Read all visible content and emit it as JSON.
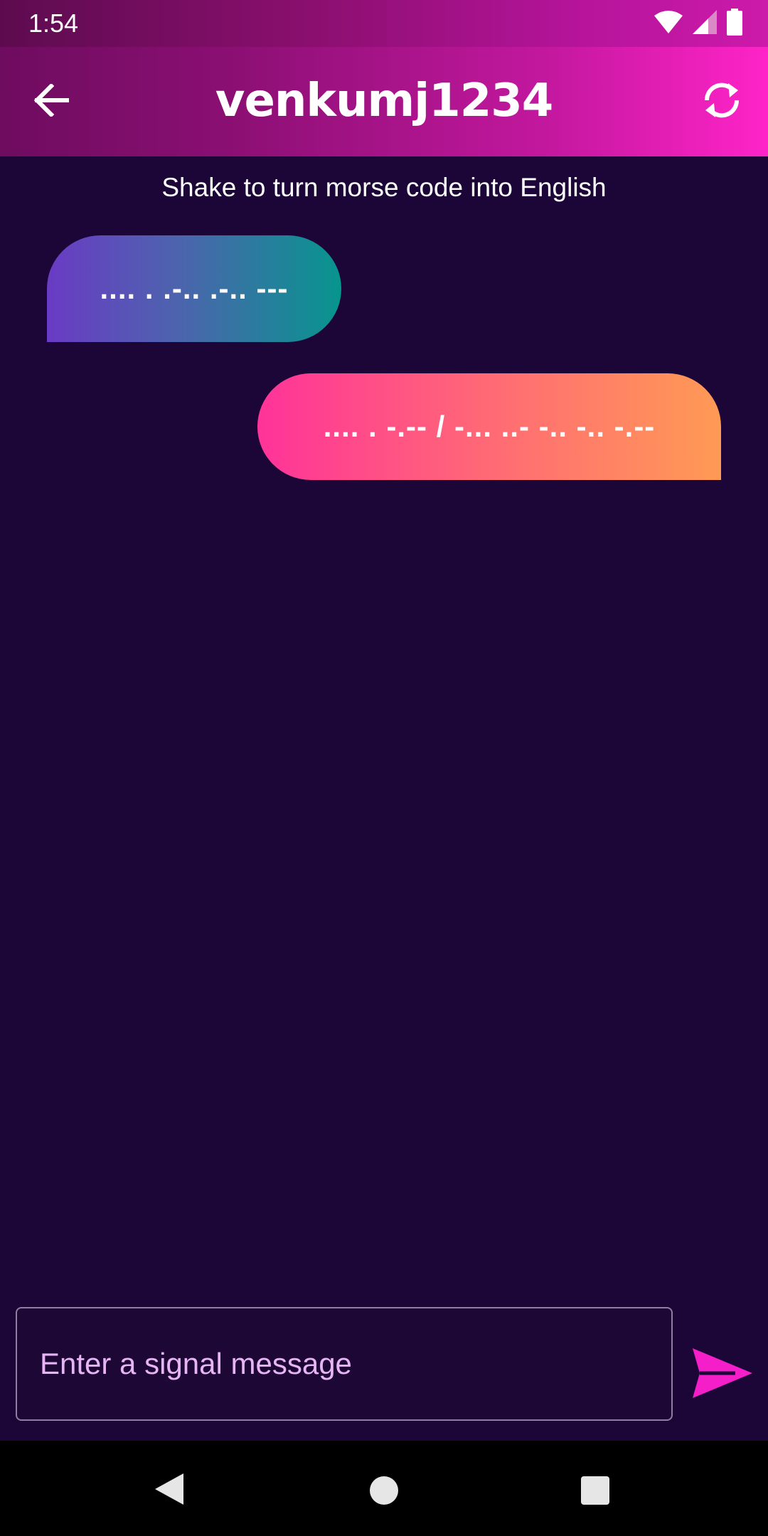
{
  "status_bar": {
    "time": "1:54",
    "icons": [
      "wifi-icon",
      "signal-icon",
      "battery-icon"
    ]
  },
  "app_bar": {
    "title": "venkumj1234",
    "back_icon": "arrow-left-icon",
    "refresh_icon": "refresh-icon"
  },
  "hint": "Shake to turn morse code into English",
  "messages": [
    {
      "direction": "received",
      "text": ".... . .-.. .-.. ---"
    },
    {
      "direction": "sent",
      "text": ".... . -.-- / -... ..- -.. -.. -.--"
    }
  ],
  "composer": {
    "placeholder": "Enter a signal message",
    "value": "",
    "send_icon": "send-icon"
  },
  "nav_bar": {
    "icons": [
      "nav-back-icon",
      "nav-home-icon",
      "nav-recents-icon"
    ]
  },
  "colors": {
    "background": "#1b0637",
    "accent": "#ff24c8",
    "send": "#f51fc9"
  }
}
